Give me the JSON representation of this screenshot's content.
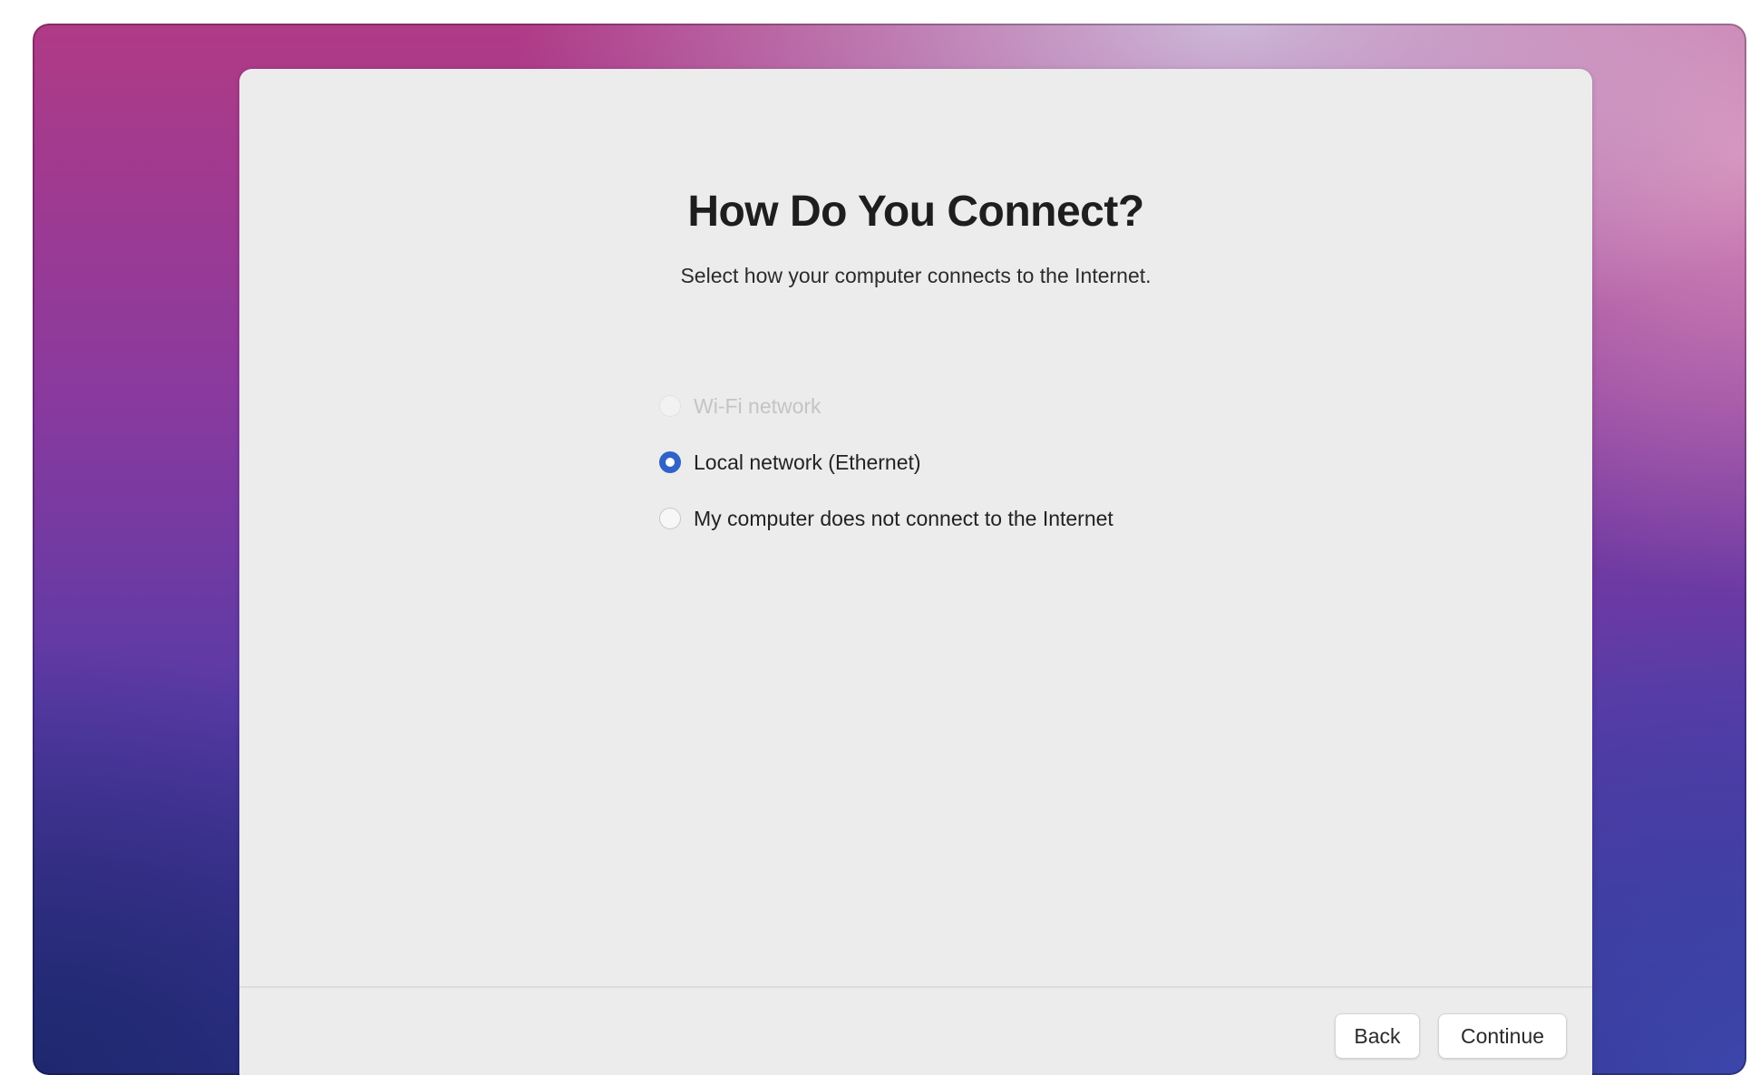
{
  "dialog": {
    "title": "How Do You Connect?",
    "subtitle": "Select how your computer connects to the Internet.",
    "options": [
      {
        "label": "Wi-Fi network",
        "state": "disabled"
      },
      {
        "label": "Local network (Ethernet)",
        "state": "selected"
      },
      {
        "label": "My computer does not connect to the Internet",
        "state": "unselected"
      }
    ],
    "buttons": {
      "back": "Back",
      "continue": "Continue"
    }
  },
  "colors": {
    "accent": "#2f63c9",
    "dialog_background": "#ececec",
    "disabled_text": "#c4c4c4"
  }
}
